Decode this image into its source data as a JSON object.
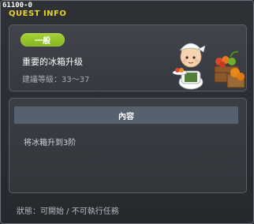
{
  "window": {
    "quest_id": "61100-0",
    "title": "QUEST INFO"
  },
  "quest": {
    "category_badge": "一般",
    "name": "重要的冰箱升级",
    "recommended_level": "建議等級：33～37",
    "npc_icon": "chef-npc-with-vegetable-crates"
  },
  "content": {
    "header": "內容",
    "text": "将冰箱升到3阶"
  },
  "status": {
    "text": "狀態：可開始 / 不可執行任務"
  },
  "colors": {
    "title": "#e8d12b",
    "badge": "#9ac932",
    "content_header": "#55626d"
  }
}
